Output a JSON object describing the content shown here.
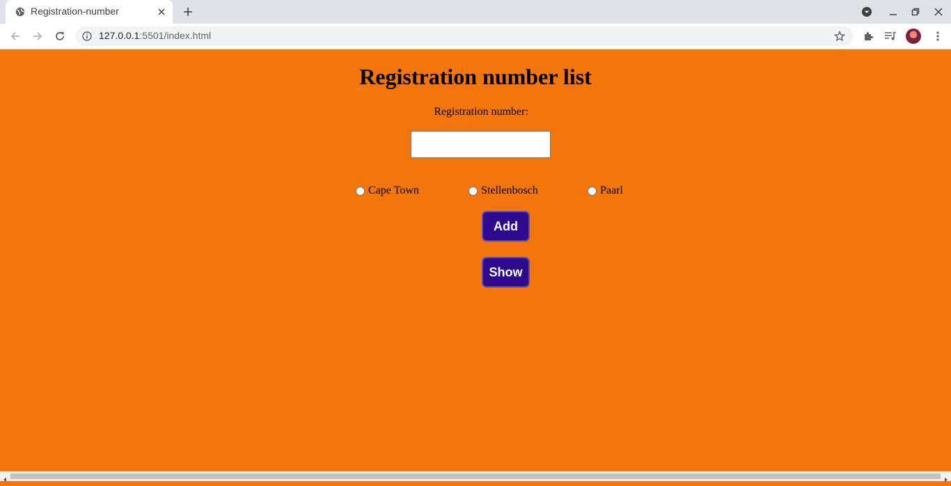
{
  "browser": {
    "tab_title": "Registration-number",
    "url_host": "127.0.0.1",
    "url_rest": ":5501/index.html"
  },
  "page": {
    "title": "Registration number list",
    "reg_label": "Registration number:",
    "reg_input_value": "",
    "radios": [
      {
        "label": "Cape Town",
        "checked": false
      },
      {
        "label": "Stellenbosch",
        "checked": false
      },
      {
        "label": "Paarl",
        "checked": false
      }
    ],
    "add_button": "Add",
    "show_button": "Show"
  },
  "colors": {
    "page_background": "#f3760c",
    "button_background": "#2e0a8f",
    "button_text": "#ffffff"
  }
}
